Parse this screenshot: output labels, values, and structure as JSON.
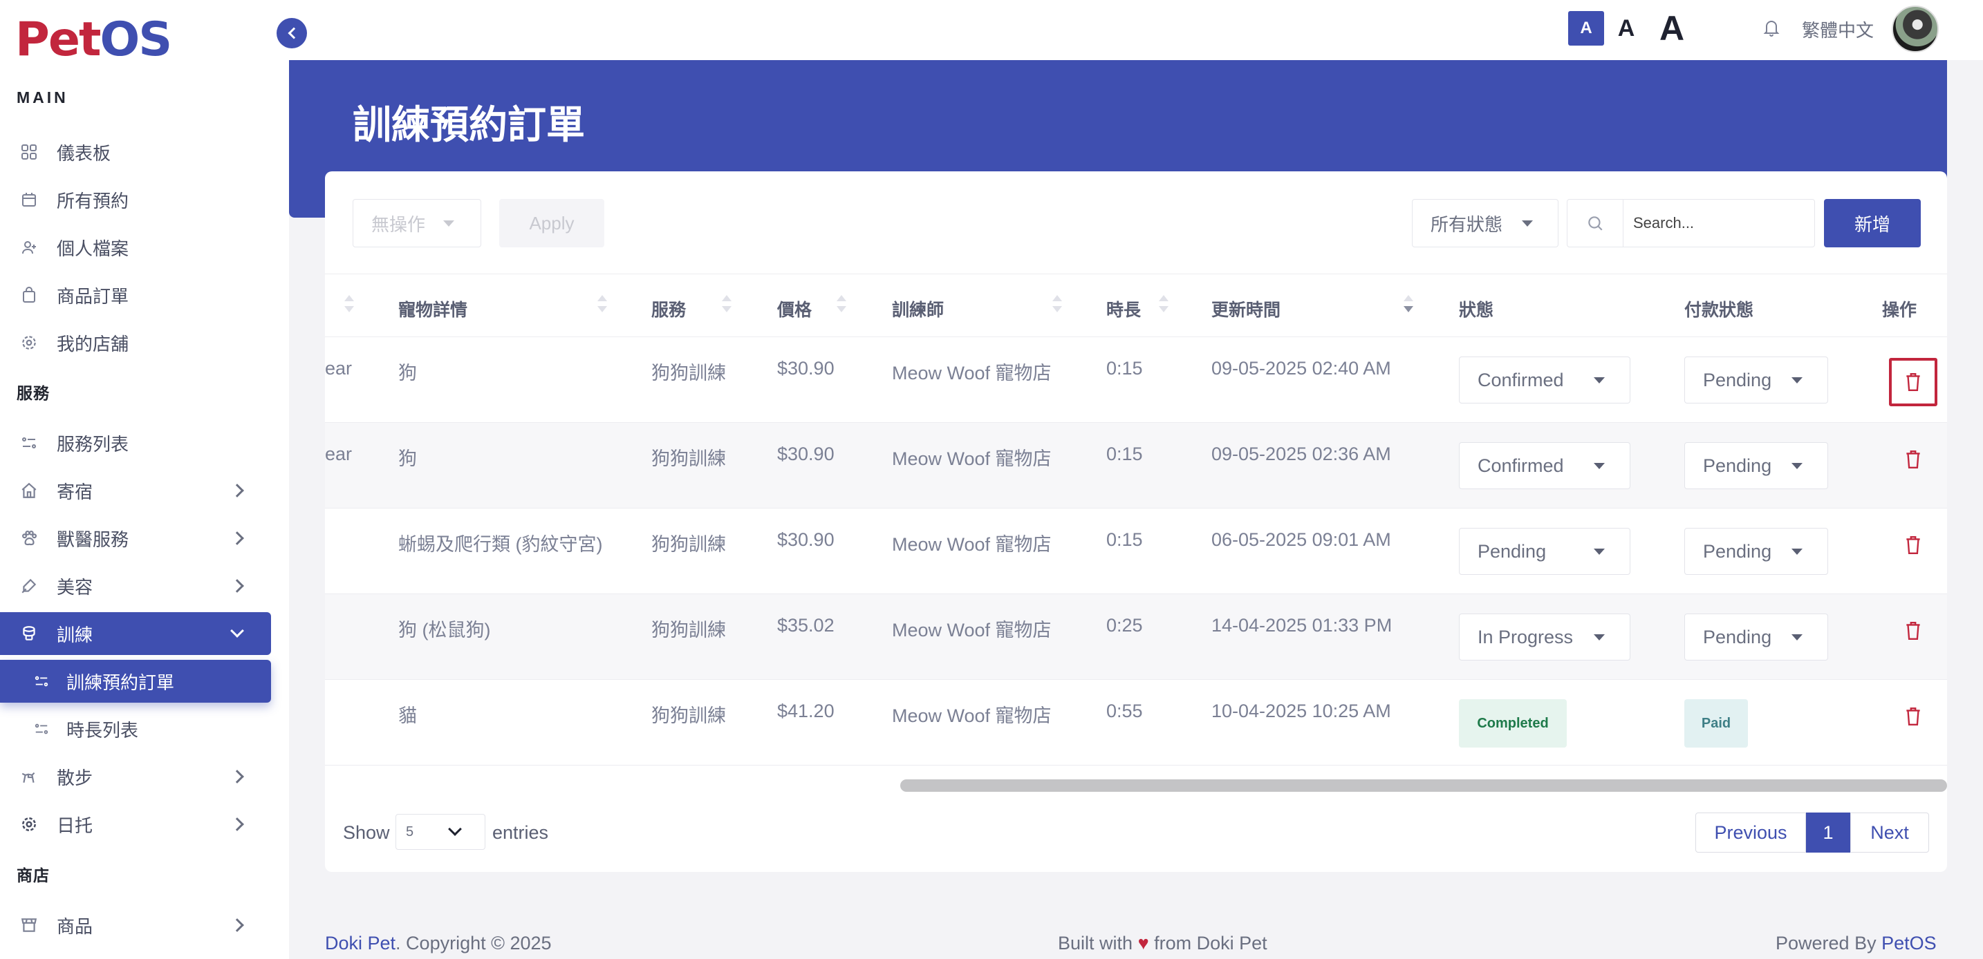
{
  "app": {
    "logo": {
      "part1": "Pet",
      "part2": "OS"
    },
    "language": "繁體中文",
    "font_sizes": [
      "A",
      "A",
      "A"
    ],
    "accent_color": "#3f4fb0",
    "brand_red": "#c2263d"
  },
  "sidebar": {
    "section_main": "MAIN",
    "main_items": [
      {
        "label": "儀表板",
        "icon": "grid-icon"
      },
      {
        "label": "所有預約",
        "icon": "calendar-icon"
      },
      {
        "label": "個人檔案",
        "icon": "user-icon"
      },
      {
        "label": "商品訂單",
        "icon": "bag-icon"
      },
      {
        "label": "我的店舖",
        "icon": "gear-icon"
      }
    ],
    "section_services": "服務",
    "service_items": [
      {
        "label": "服務列表",
        "icon": "list-icon"
      },
      {
        "label": "寄宿",
        "icon": "home-icon"
      },
      {
        "label": "獸醫服務",
        "icon": "paw-icon"
      },
      {
        "label": "美容",
        "icon": "brush-icon"
      },
      {
        "label": "訓練",
        "icon": "training-icon"
      }
    ],
    "training_sub": [
      {
        "label": "訓練預約訂單",
        "icon": "list-icon"
      },
      {
        "label": "時長列表",
        "icon": "list-icon"
      }
    ],
    "more_items": [
      {
        "label": "散步",
        "icon": "walk-icon"
      },
      {
        "label": "日托",
        "icon": "daycare-icon"
      }
    ],
    "section_shop": "商店",
    "shop_items": [
      {
        "label": "商品",
        "icon": "store-icon"
      }
    ]
  },
  "page": {
    "title": "訓練預約訂單"
  },
  "toolbar": {
    "bulk_action": "無操作",
    "apply": "Apply",
    "status_filter": "所有狀態",
    "search_placeholder": "Search...",
    "add": "新增"
  },
  "table": {
    "columns": [
      "寵物詳情",
      "服務",
      "價格",
      "訓練師",
      "時長",
      "更新時間",
      "狀態",
      "付款狀態",
      "操作"
    ],
    "rows": [
      {
        "clipped": "ear",
        "pet": "狗",
        "service": "狗狗訓練",
        "price": "$30.90",
        "trainer": "Meow Woof 寵物店",
        "duration": "0:15",
        "updated": "09-05-2025 02:40 AM",
        "status": "Confirmed",
        "payment": "Pending"
      },
      {
        "clipped": "ear",
        "pet": "狗",
        "service": "狗狗訓練",
        "price": "$30.90",
        "trainer": "Meow Woof 寵物店",
        "duration": "0:15",
        "updated": "09-05-2025 02:36 AM",
        "status": "Confirmed",
        "payment": "Pending"
      },
      {
        "clipped": "",
        "pet": "蜥蜴及爬行類 (豹紋守宮)",
        "service": "狗狗訓練",
        "price": "$30.90",
        "trainer": "Meow Woof 寵物店",
        "duration": "0:15",
        "updated": "06-05-2025 09:01 AM",
        "status": "Pending",
        "payment": "Pending"
      },
      {
        "clipped": "",
        "pet": "狗 (松鼠狗)",
        "service": "狗狗訓練",
        "price": "$35.02",
        "trainer": "Meow Woof 寵物店",
        "duration": "0:25",
        "updated": "14-04-2025 01:33 PM",
        "status": "In Progress",
        "payment": "Pending"
      },
      {
        "clipped": "",
        "pet": "貓",
        "service": "狗狗訓練",
        "price": "$41.20",
        "trainer": "Meow Woof 寵物店",
        "duration": "0:55",
        "updated": "10-04-2025 10:25 AM",
        "status": "Completed",
        "payment": "Paid"
      }
    ]
  },
  "pagination": {
    "show": "Show",
    "page_size": "5",
    "entries": "entries",
    "previous": "Previous",
    "current": "1",
    "next": "Next"
  },
  "footer": {
    "brand": "Doki Pet",
    "copyright": ". Copyright © 2025",
    "built_with": "Built with",
    "heart": "♥",
    "from": "from Doki Pet",
    "powered_by": "Powered By",
    "powered_brand": "PetOS"
  }
}
